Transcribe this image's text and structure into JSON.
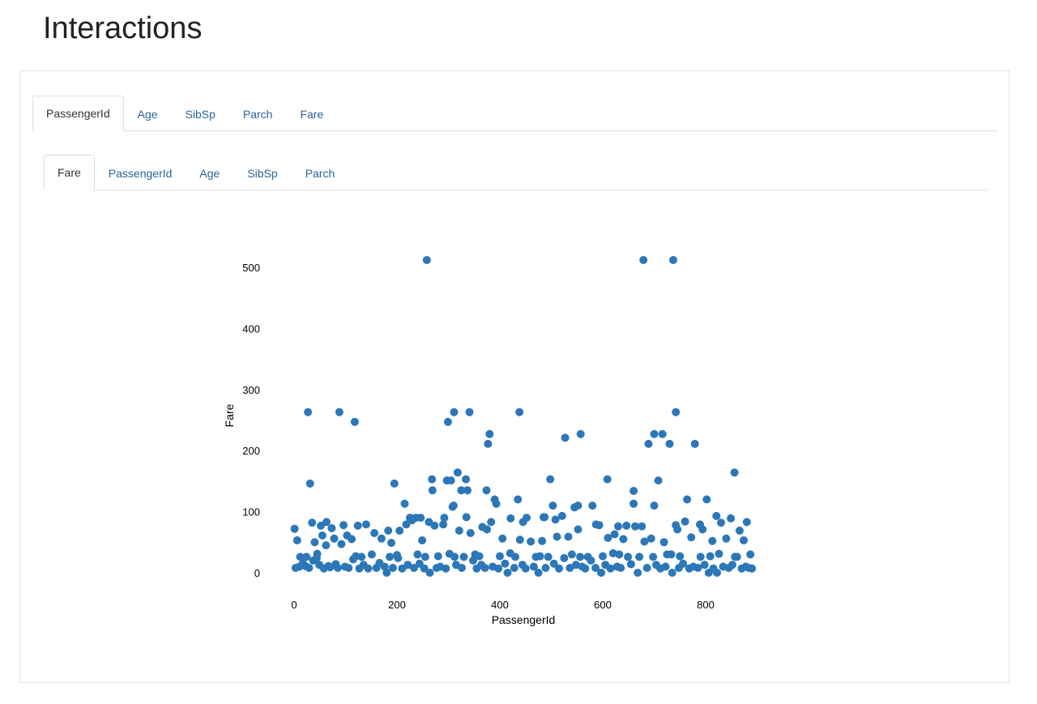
{
  "page": {
    "title": "Interactions"
  },
  "outer_tabs": {
    "items": [
      {
        "label": "PassengerId",
        "active": true
      },
      {
        "label": "Age",
        "active": false
      },
      {
        "label": "SibSp",
        "active": false
      },
      {
        "label": "Parch",
        "active": false
      },
      {
        "label": "Fare",
        "active": false
      }
    ]
  },
  "inner_tabs": {
    "items": [
      {
        "label": "Fare",
        "active": true
      },
      {
        "label": "PassengerId",
        "active": false
      },
      {
        "label": "Age",
        "active": false
      },
      {
        "label": "SibSp",
        "active": false
      },
      {
        "label": "Parch",
        "active": false
      }
    ]
  },
  "colors": {
    "marker": "#2c77b8",
    "link": "#2a6496",
    "border": "#dddddd"
  },
  "chart_data": {
    "type": "scatter",
    "title": "",
    "xlabel": "PassengerId",
    "ylabel": "Fare",
    "xlim": [
      0,
      891
    ],
    "ylim": [
      0,
      512
    ],
    "x_ticks": [
      0,
      200,
      400,
      600,
      800
    ],
    "y_ticks": [
      0,
      100,
      200,
      300,
      400,
      500
    ],
    "grid": false,
    "legend": "none",
    "series": [
      {
        "points": [
          [
            258,
            512
          ],
          [
            679,
            512
          ],
          [
            737,
            512
          ],
          [
            27,
            263
          ],
          [
            88,
            263
          ],
          [
            311,
            263
          ],
          [
            341,
            263
          ],
          [
            438,
            263
          ],
          [
            742,
            263
          ],
          [
            118,
            247
          ],
          [
            299,
            247
          ],
          [
            380,
            227
          ],
          [
            557,
            227
          ],
          [
            700,
            227
          ],
          [
            716,
            227
          ],
          [
            377,
            211
          ],
          [
            689,
            211
          ],
          [
            730,
            211
          ],
          [
            779,
            211
          ],
          [
            527,
            221
          ],
          [
            318,
            164
          ],
          [
            856,
            164
          ],
          [
            268,
            153
          ],
          [
            297,
            151
          ],
          [
            305,
            151
          ],
          [
            334,
            153
          ],
          [
            498,
            153
          ],
          [
            609,
            153
          ],
          [
            708,
            151
          ],
          [
            31,
            146
          ],
          [
            195,
            146
          ],
          [
            269,
            135
          ],
          [
            325,
            135
          ],
          [
            337,
            135
          ],
          [
            374,
            135
          ],
          [
            660,
            134
          ],
          [
            390,
            120
          ],
          [
            435,
            120
          ],
          [
            764,
            120
          ],
          [
            802,
            120
          ],
          [
            393,
            113
          ],
          [
            215,
            113
          ],
          [
            308,
            108
          ],
          [
            503,
            110
          ],
          [
            545,
            107
          ],
          [
            552,
            110
          ],
          [
            580,
            110
          ],
          [
            660,
            113
          ],
          [
            700,
            110
          ],
          [
            335,
            91
          ],
          [
            310,
            110
          ],
          [
            225,
            90
          ],
          [
            487,
            91
          ],
          [
            521,
            93
          ],
          [
            821,
            93
          ],
          [
            849,
            89
          ],
          [
            35,
            82
          ],
          [
            63,
            83
          ],
          [
            96,
            78
          ],
          [
            140,
            79
          ],
          [
            485,
            91
          ],
          [
            237,
            90
          ],
          [
            246,
            90
          ],
          [
            262,
            83
          ],
          [
            292,
            90
          ],
          [
            366,
            75
          ],
          [
            383,
            83
          ],
          [
            445,
            83
          ],
          [
            452,
            90
          ],
          [
            508,
            87
          ],
          [
            587,
            79
          ],
          [
            630,
            76
          ],
          [
            646,
            77
          ],
          [
            663,
            76
          ],
          [
            676,
            76
          ],
          [
            742,
            78
          ],
          [
            760,
            84
          ],
          [
            789,
            79
          ],
          [
            830,
            82
          ],
          [
            880,
            83
          ],
          [
            1,
            72
          ],
          [
            52,
            77
          ],
          [
            73,
            73
          ],
          [
            103,
            61
          ],
          [
            124,
            77
          ],
          [
            156,
            65
          ],
          [
            183,
            69
          ],
          [
            205,
            69
          ],
          [
            218,
            79
          ],
          [
            229,
            86
          ],
          [
            249,
            53
          ],
          [
            273,
            77
          ],
          [
            290,
            79
          ],
          [
            321,
            69
          ],
          [
            343,
            65
          ],
          [
            375,
            71
          ],
          [
            405,
            56
          ],
          [
            421,
            89
          ],
          [
            439,
            54
          ],
          [
            460,
            51
          ],
          [
            482,
            52
          ],
          [
            511,
            59
          ],
          [
            533,
            59
          ],
          [
            552,
            71
          ],
          [
            593,
            78
          ],
          [
            610,
            57
          ],
          [
            623,
            63
          ],
          [
            640,
            55
          ],
          [
            681,
            51
          ],
          [
            694,
            56
          ],
          [
            719,
            50
          ],
          [
            745,
            71
          ],
          [
            772,
            58
          ],
          [
            794,
            71
          ],
          [
            813,
            52
          ],
          [
            840,
            56
          ],
          [
            866,
            69
          ],
          [
            874,
            53
          ],
          [
            6,
            53
          ],
          [
            24,
            26
          ],
          [
            40,
            50
          ],
          [
            55,
            61
          ],
          [
            62,
            45
          ],
          [
            78,
            56
          ],
          [
            92,
            47
          ],
          [
            112,
            55
          ],
          [
            131,
            26
          ],
          [
            151,
            30
          ],
          [
            170,
            56
          ],
          [
            189,
            49
          ],
          [
            200,
            29
          ],
          [
            240,
            30
          ],
          [
            280,
            27
          ],
          [
            302,
            31
          ],
          [
            330,
            26
          ],
          [
            360,
            27
          ],
          [
            400,
            27
          ],
          [
            420,
            32
          ],
          [
            470,
            26
          ],
          [
            494,
            26
          ],
          [
            540,
            30
          ],
          [
            571,
            26
          ],
          [
            600,
            27
          ],
          [
            620,
            32
          ],
          [
            649,
            26
          ],
          [
            698,
            26
          ],
          [
            725,
            30
          ],
          [
            750,
            27
          ],
          [
            790,
            26
          ],
          [
            826,
            31
          ],
          [
            861,
            26
          ],
          [
            887,
            30
          ],
          [
            3,
            8
          ],
          [
            10,
            10
          ],
          [
            17,
            15
          ],
          [
            22,
            11
          ],
          [
            29,
            8
          ],
          [
            37,
            20
          ],
          [
            44,
            24
          ],
          [
            49,
            13
          ],
          [
            58,
            7
          ],
          [
            67,
            11
          ],
          [
            70,
            9
          ],
          [
            81,
            14
          ],
          [
            85,
            8
          ],
          [
            99,
            10
          ],
          [
            106,
            8
          ],
          [
            115,
            22
          ],
          [
            127,
            7
          ],
          [
            135,
            13
          ],
          [
            144,
            7
          ],
          [
            160,
            8
          ],
          [
            166,
            16
          ],
          [
            176,
            10
          ],
          [
            180,
            0
          ],
          [
            192,
            8
          ],
          [
            202,
            24
          ],
          [
            210,
            7
          ],
          [
            221,
            13
          ],
          [
            233,
            8
          ],
          [
            244,
            15
          ],
          [
            253,
            7
          ],
          [
            264,
            0
          ],
          [
            277,
            8
          ],
          [
            284,
            10
          ],
          [
            295,
            7
          ],
          [
            315,
            13
          ],
          [
            326,
            8
          ],
          [
            348,
            20
          ],
          [
            355,
            7
          ],
          [
            364,
            13
          ],
          [
            371,
            8
          ],
          [
            386,
            10
          ],
          [
            397,
            7
          ],
          [
            410,
            15
          ],
          [
            415,
            0
          ],
          [
            428,
            8
          ],
          [
            444,
            13
          ],
          [
            450,
            7
          ],
          [
            466,
            10
          ],
          [
            475,
            0
          ],
          [
            489,
            8
          ],
          [
            505,
            15
          ],
          [
            515,
            7
          ],
          [
            525,
            24
          ],
          [
            536,
            8
          ],
          [
            548,
            13
          ],
          [
            560,
            10
          ],
          [
            566,
            7
          ],
          [
            577,
            20
          ],
          [
            586,
            8
          ],
          [
            597,
            0
          ],
          [
            605,
            13
          ],
          [
            615,
            7
          ],
          [
            628,
            10
          ],
          [
            635,
            8
          ],
          [
            655,
            14
          ],
          [
            668,
            0
          ],
          [
            686,
            8
          ],
          [
            704,
            13
          ],
          [
            712,
            7
          ],
          [
            722,
            10
          ],
          [
            735,
            0
          ],
          [
            748,
            8
          ],
          [
            756,
            15
          ],
          [
            768,
            7
          ],
          [
            776,
            10
          ],
          [
            785,
            8
          ],
          [
            798,
            13
          ],
          [
            806,
            0
          ],
          [
            815,
            7
          ],
          [
            822,
            0
          ],
          [
            834,
            10
          ],
          [
            845,
            8
          ],
          [
            852,
            13
          ],
          [
            870,
            7
          ],
          [
            878,
            10
          ],
          [
            884,
            8
          ],
          [
            890,
            7
          ],
          [
            12,
            26
          ],
          [
            45,
            31
          ],
          [
            120,
            27
          ],
          [
            186,
            26
          ],
          [
            255,
            26
          ],
          [
            312,
            26
          ],
          [
            352,
            30
          ],
          [
            430,
            26
          ],
          [
            478,
            27
          ],
          [
            556,
            26
          ],
          [
            632,
            30
          ],
          [
            671,
            26
          ],
          [
            733,
            30
          ],
          [
            809,
            27
          ],
          [
            857,
            26
          ]
        ]
      }
    ]
  }
}
